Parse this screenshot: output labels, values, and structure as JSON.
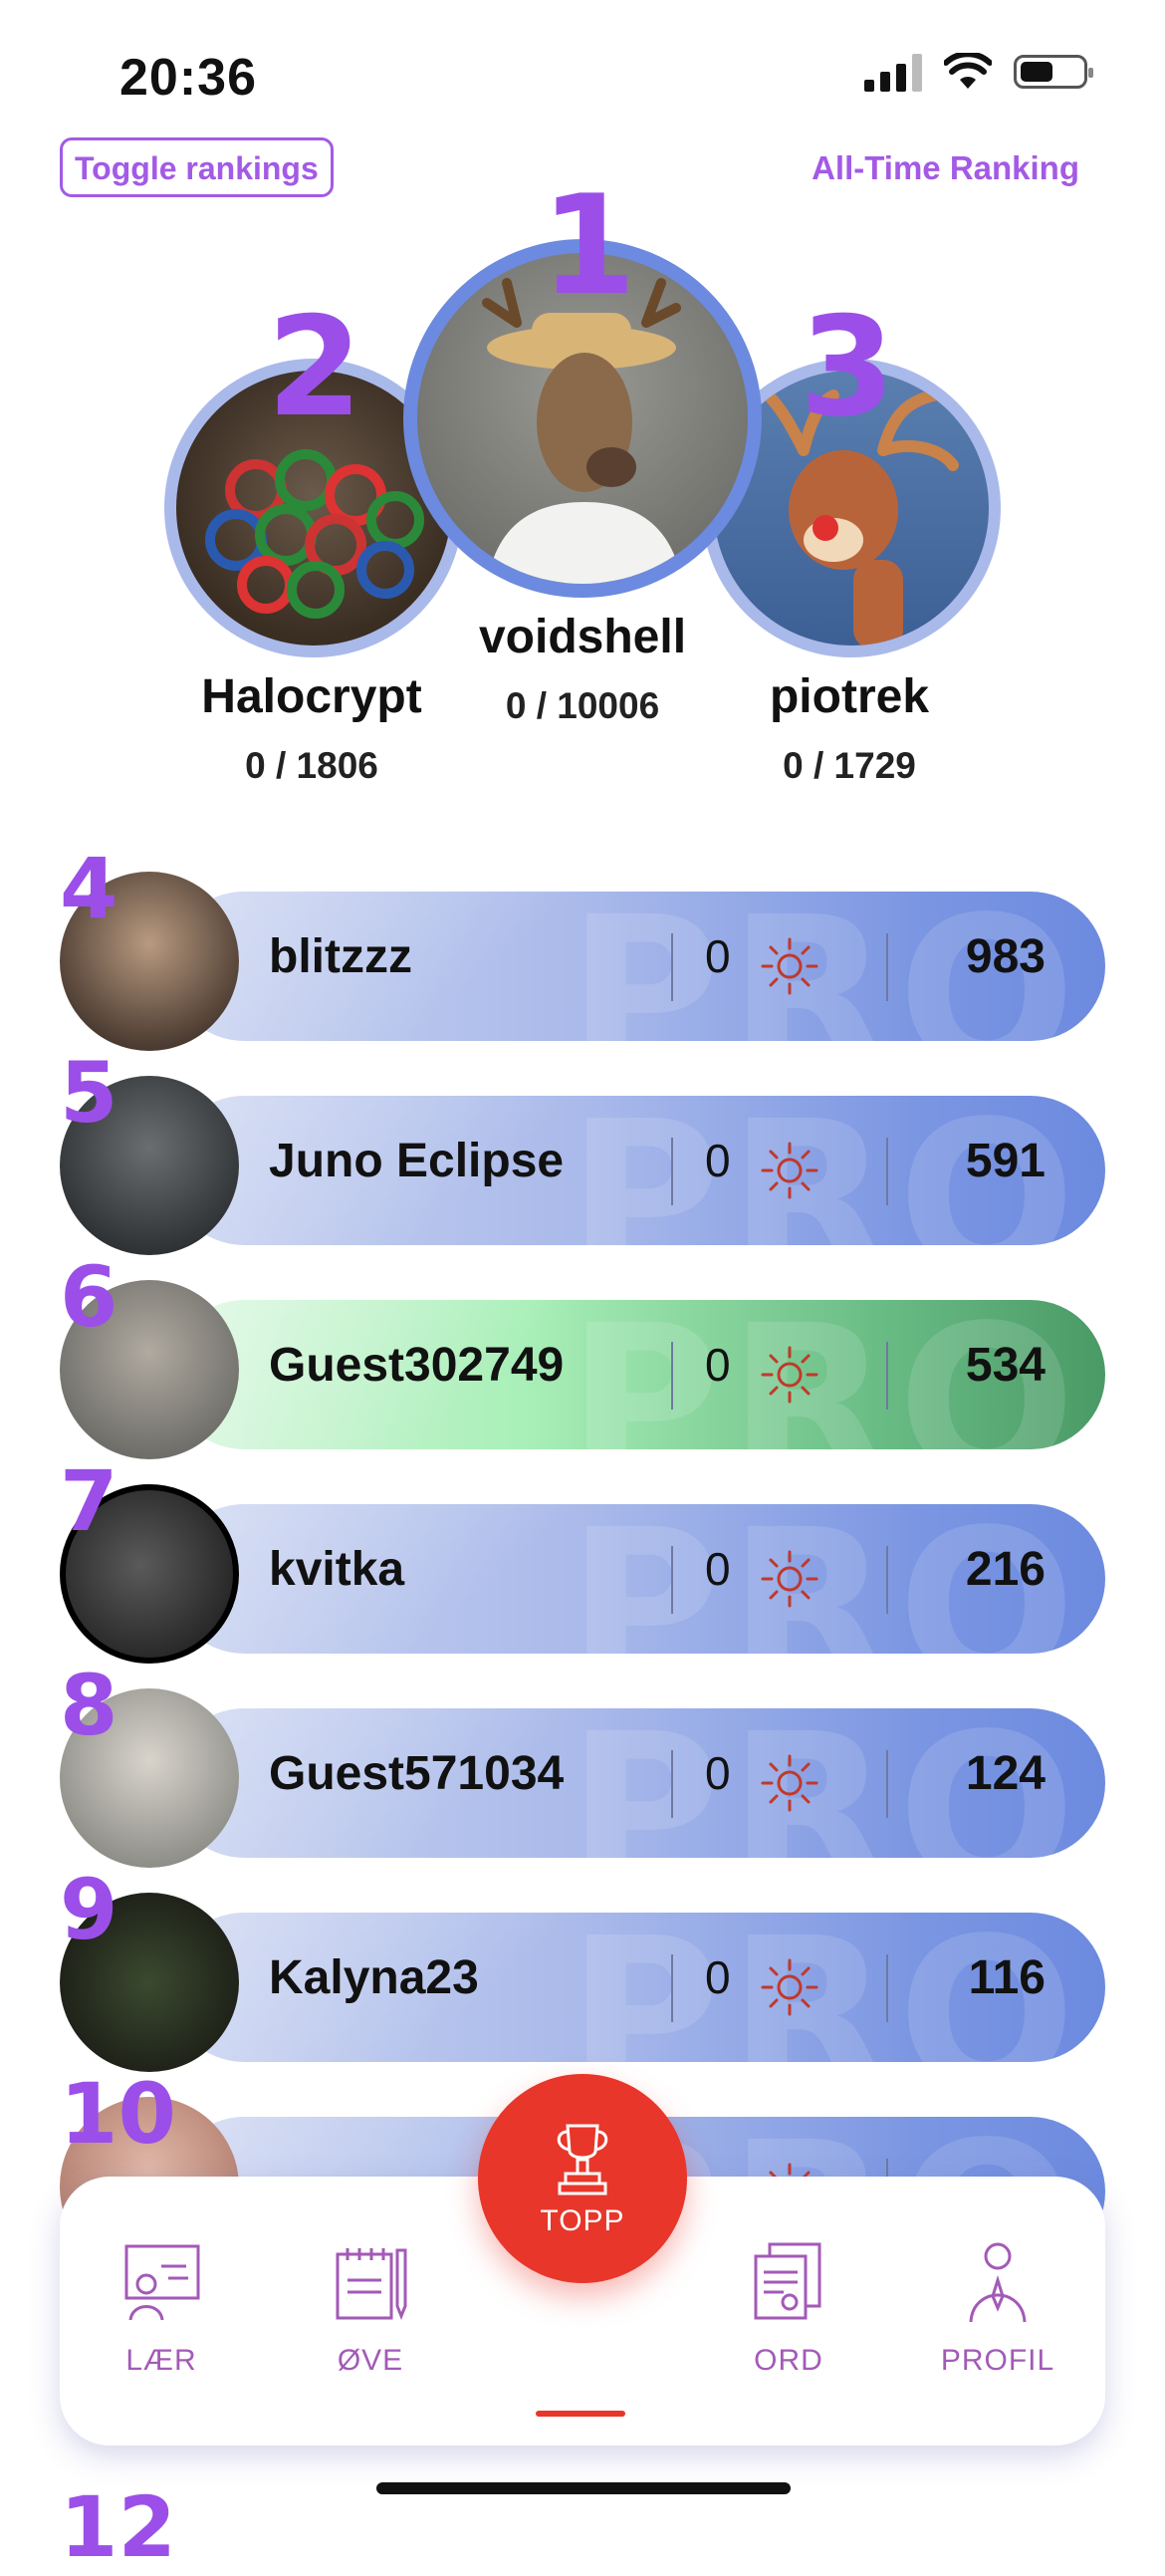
{
  "status_bar": {
    "time": "20:36"
  },
  "header": {
    "toggle_label": "Toggle rankings",
    "alltime_label": "All-Time Ranking"
  },
  "podium": [
    {
      "rank": "1",
      "name": "voidshell",
      "score": "0 / 10006"
    },
    {
      "rank": "2",
      "name": "Halocrypt",
      "score": "0 / 1806"
    },
    {
      "rank": "3",
      "name": "piotrek",
      "score": "0 / 1729"
    }
  ],
  "rows": [
    {
      "rank": "4",
      "name": "blitzzz",
      "zero": "0",
      "score": "983",
      "watermark": "PRO"
    },
    {
      "rank": "5",
      "name": "Juno Eclipse",
      "zero": "0",
      "score": "591",
      "watermark": "PRO"
    },
    {
      "rank": "6",
      "name": "Guest302749",
      "zero": "0",
      "score": "534",
      "watermark": "PRO"
    },
    {
      "rank": "7",
      "name": "kvitka",
      "zero": "0",
      "score": "216",
      "watermark": "PRO"
    },
    {
      "rank": "8",
      "name": "Guest571034",
      "zero": "0",
      "score": "124",
      "watermark": "PRO"
    },
    {
      "rank": "9",
      "name": "Kalyna23",
      "zero": "0",
      "score": "116",
      "watermark": "PRO"
    },
    {
      "rank": "10",
      "name": "",
      "zero": "",
      "score": "",
      "watermark": "PRO"
    }
  ],
  "peek_rank": "12",
  "nav": {
    "learn": "LÆR",
    "practice": "ØVE",
    "top": "TOPP",
    "words": "ORD",
    "profile": "PROFIL"
  },
  "colors": {
    "accent_purple": "#9b4fe8",
    "fab_red": "#e8362a",
    "bar_blue": "#6c8adf",
    "bar_green": "#4a9a66"
  }
}
